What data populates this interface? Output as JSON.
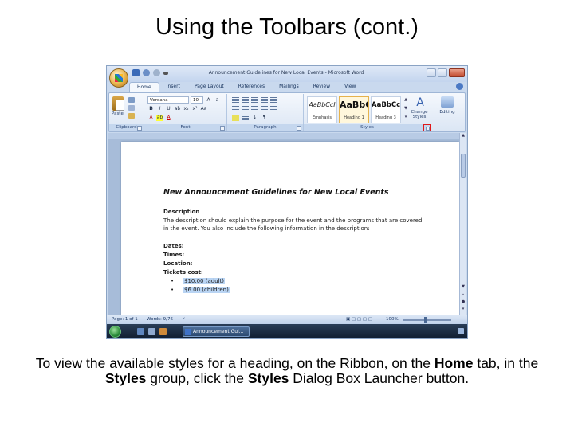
{
  "slide": {
    "title": "Using the Toolbars (cont.)",
    "caption": {
      "part1": "To view the available styles for a heading, on the Ribbon, on the ",
      "home": "Home",
      "part2": " tab, in the ",
      "styles": "Styles",
      "part3": " group, click the ",
      "styles2": "Styles",
      "part4": " Dialog Box Launcher button."
    }
  },
  "window": {
    "title": "Announcement Guidelines for New Local Events - Microsoft Word"
  },
  "ribbon": {
    "tabs": [
      "Home",
      "Insert",
      "Page Layout",
      "References",
      "Mailings",
      "Review",
      "View"
    ],
    "clipboard": {
      "paste_label": "Paste",
      "group_label": "Clipboard"
    },
    "font": {
      "font_name": "Verdana",
      "font_size": "10",
      "group_label": "Font",
      "bold": "B",
      "italic": "I",
      "underline": "U"
    },
    "paragraph": {
      "group_label": "Paragraph"
    },
    "styles": {
      "group_label": "Styles",
      "items": [
        {
          "sample": "AaBbCcI",
          "name": "Emphasis"
        },
        {
          "sample": "AaBbC",
          "name": "Heading 1"
        },
        {
          "sample": "AaBbCc",
          "name": "Heading 3"
        }
      ],
      "change_styles_line1": "Change",
      "change_styles_line2": "Styles",
      "editing_label": "Editing"
    }
  },
  "document": {
    "heading": "New Announcement Guidelines for New Local Events",
    "desc_title": "Description",
    "desc_line1": "The description should explain the purpose for the event and the programs that are covered",
    "desc_line2": "in the event. You also include the following information in the description:",
    "dates": "Dates:",
    "times": "Times:",
    "location": "Location:",
    "tickets": "Tickets cost:",
    "bullet1": "$10.00 (adult)",
    "bullet2": "$6.00 (children)"
  },
  "statusbar": {
    "page": "Page: 1 of 1",
    "words": "Words: 9/76",
    "zoom": "100%"
  },
  "taskbar": {
    "task_label": "Announcement Gui..."
  }
}
